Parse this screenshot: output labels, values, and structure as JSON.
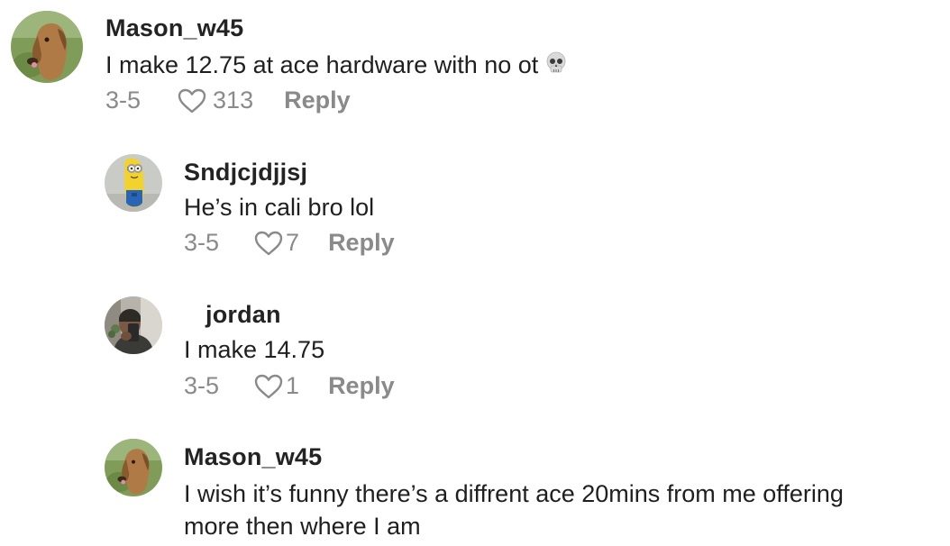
{
  "comments": [
    {
      "username": "Mason_w45",
      "text": "I make 12.75 at ace hardware with no ot",
      "emoji": "skull",
      "date": "3-5",
      "likes": "313",
      "reply_label": "Reply",
      "avatar": "dog-avatar"
    },
    {
      "username": "Sndjcjdjjsj",
      "text": "He’s in cali bro lol",
      "date": "3-5",
      "likes": "7",
      "reply_label": "Reply",
      "avatar": "minion-banana-avatar"
    },
    {
      "username": "jordan",
      "text": "I make 14.75",
      "date": "3-5",
      "likes": "1",
      "reply_label": "Reply",
      "avatar": "selfie-avatar"
    },
    {
      "username": "Mason_w45",
      "text_line1": "I wish it’s funny there’s a diffrent ace 20mins from me offering",
      "text_line2": "more then where I am",
      "avatar": "dog-avatar"
    }
  ],
  "colors": {
    "text": "#1f1f1f",
    "meta": "#8a8a8a",
    "background": "#ffffff"
  }
}
